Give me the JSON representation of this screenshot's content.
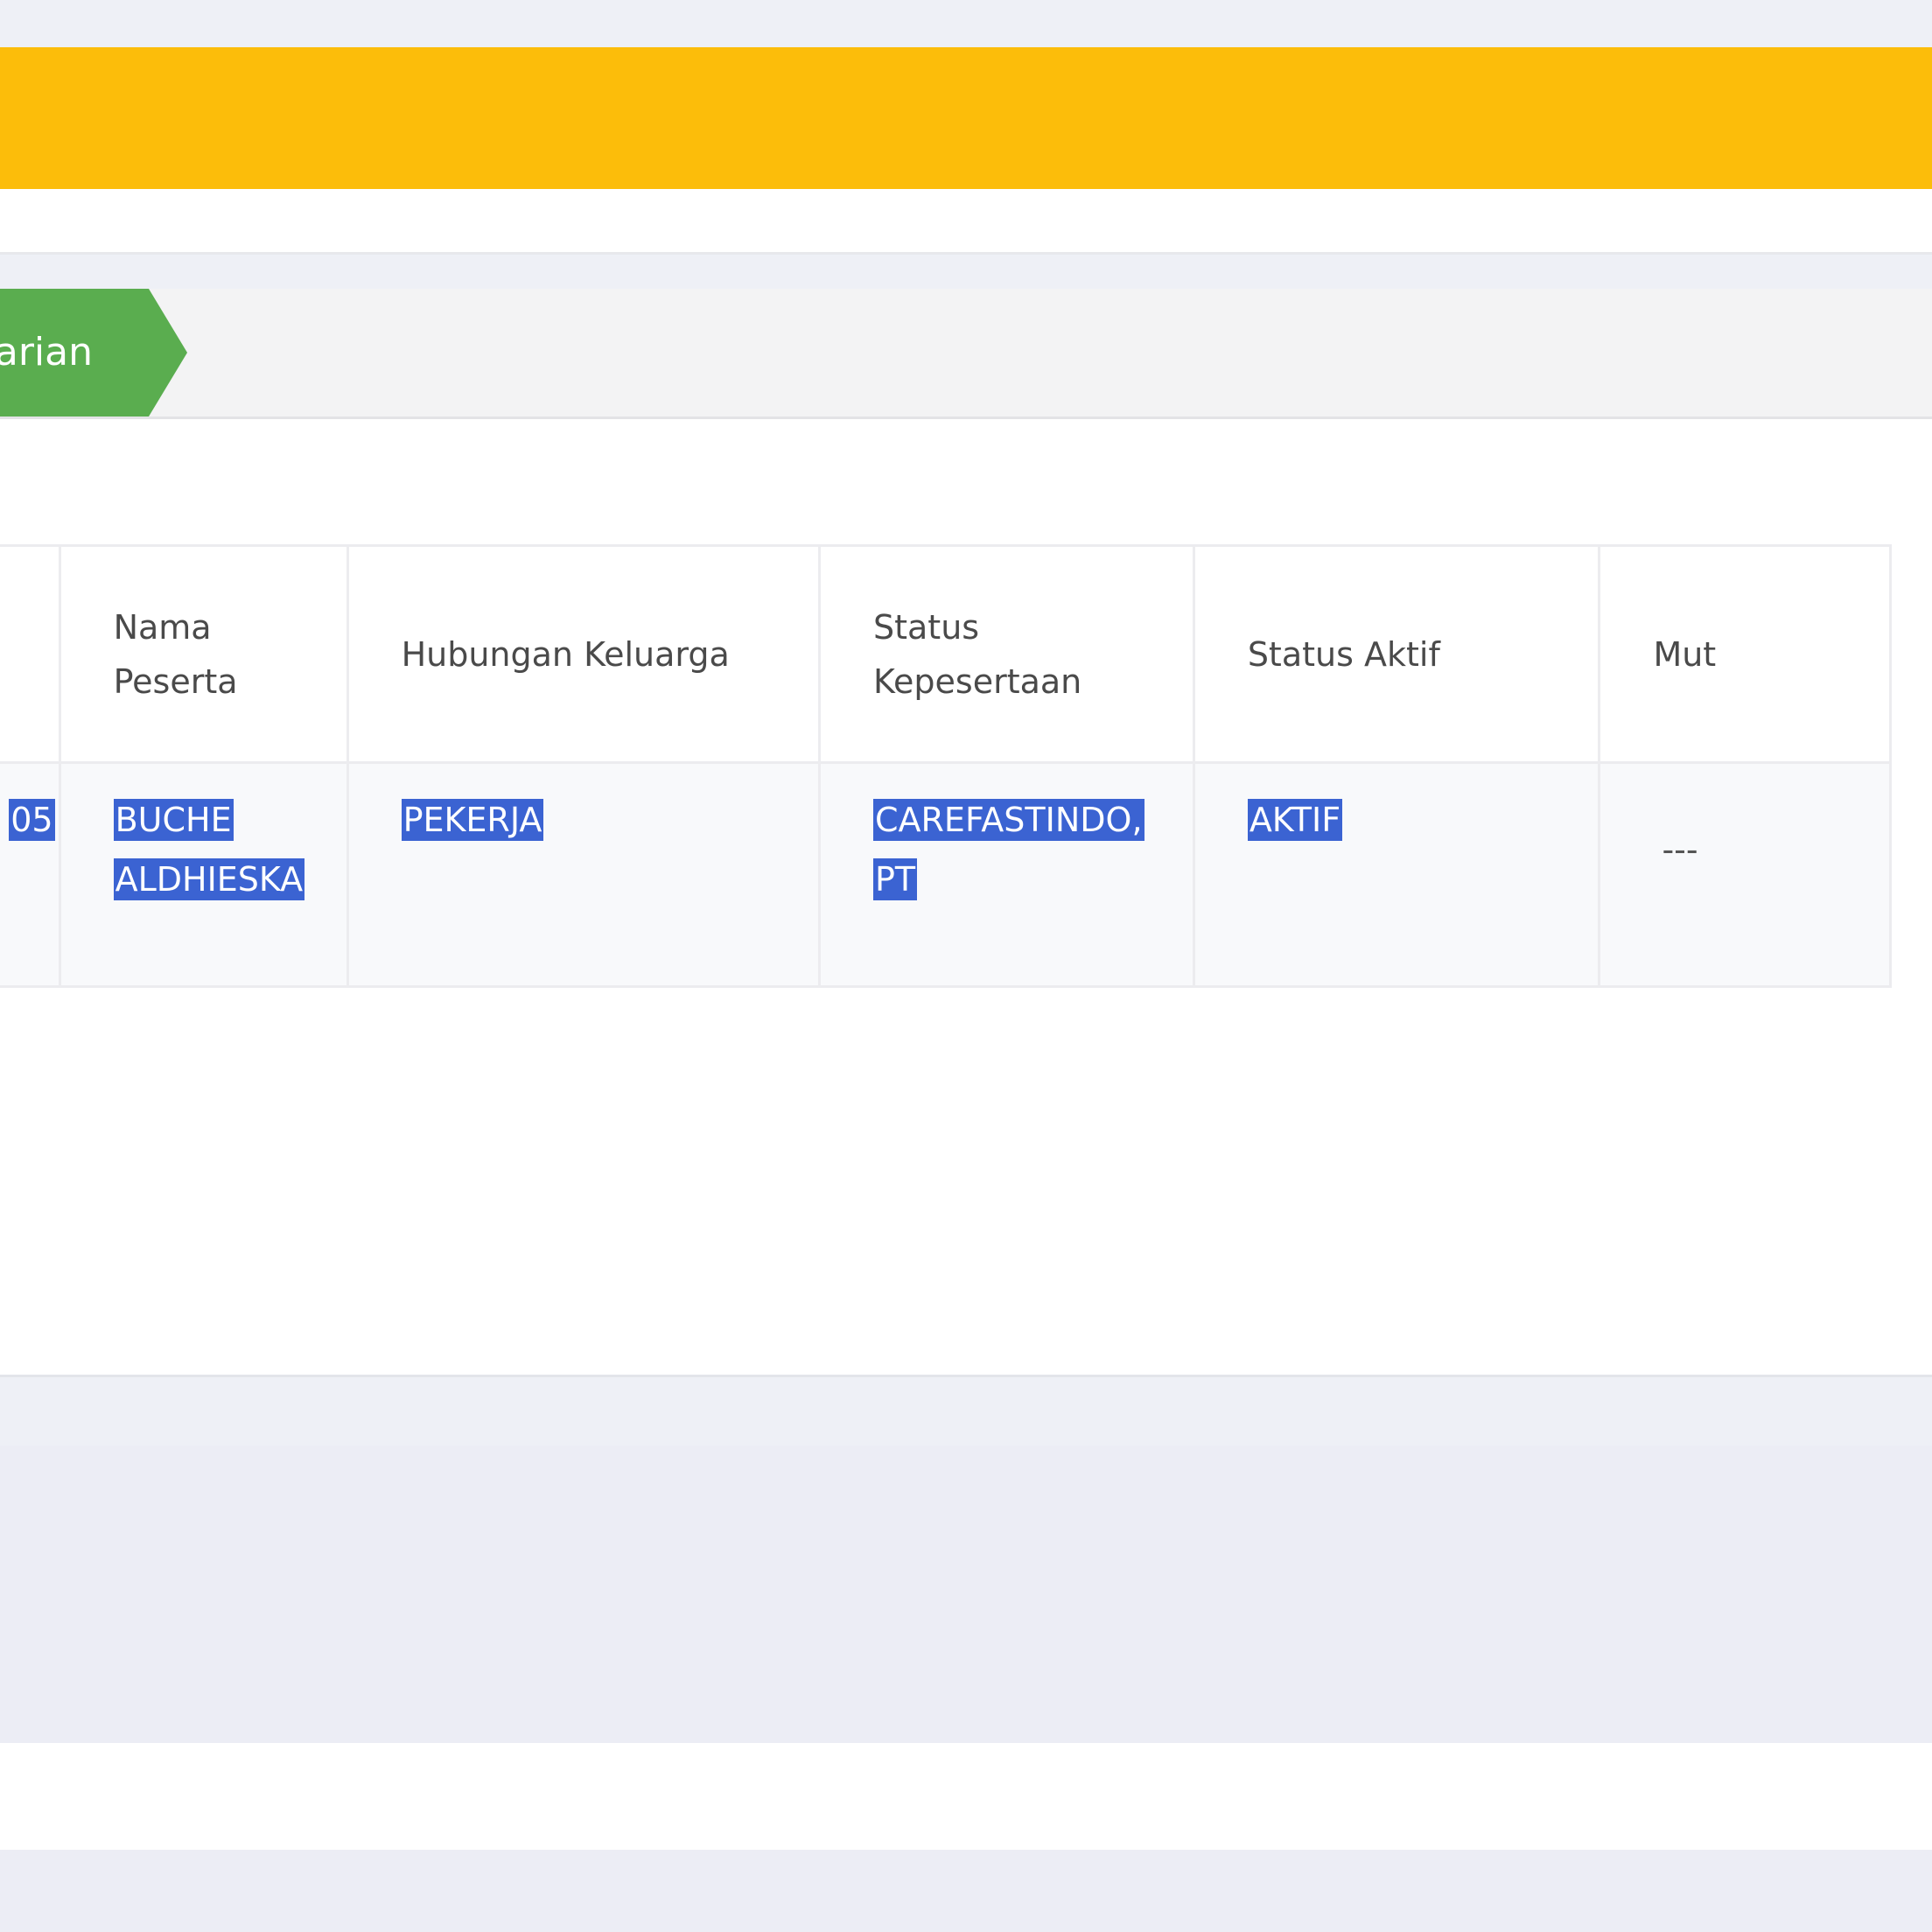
{
  "breadcrumb": {
    "active_step_label": "arian"
  },
  "table": {
    "headers": [
      "Nama Peserta",
      "Hubungan Keluarga",
      "Status Kepesertaan",
      "Status Aktif",
      "Mut"
    ],
    "rows": [
      {
        "cut_cell": "05",
        "nama_peserta": "BUCHE ALDHIESKA",
        "hubungan_keluarga": "PEKERJA",
        "status_kepesertaan": "CAREFASTINDO, PT",
        "status_aktif": "AKTIF",
        "mutasi": "---"
      }
    ]
  },
  "colors": {
    "header_bar": "#fcbd0a",
    "breadcrumb_active": "#5aad4f",
    "selection": "#3b63d2",
    "page_background": "#eef0f6"
  }
}
